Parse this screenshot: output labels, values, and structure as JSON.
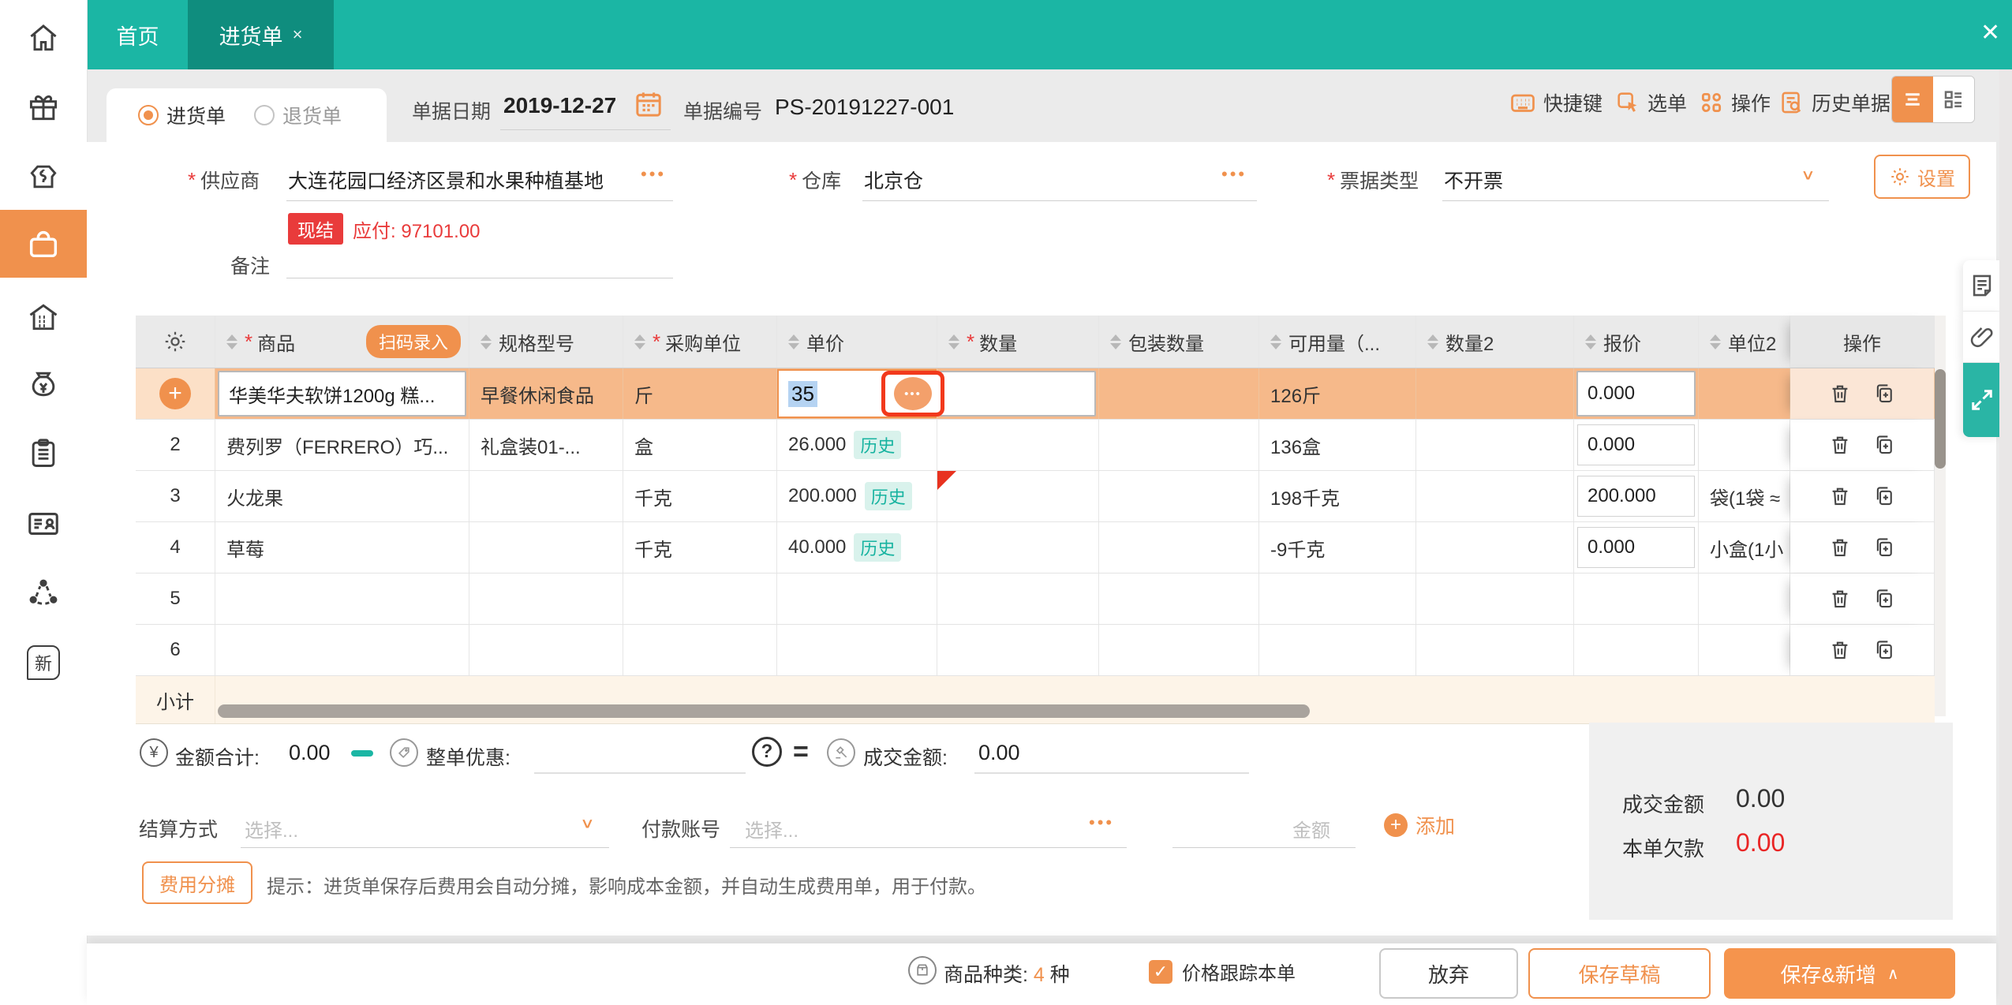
{
  "topbar": {
    "tabs": [
      {
        "label": "首页"
      },
      {
        "label": "进货单"
      }
    ],
    "tab_close": "×",
    "window_close": "✕"
  },
  "sidebar": {
    "new_badge": "新"
  },
  "header": {
    "type_options": [
      {
        "label": "进货单"
      },
      {
        "label": "退货单"
      }
    ],
    "date_label": "单据日期",
    "date_value": "2019-12-27",
    "number_label": "单据编号",
    "number_value": "PS-20191227-001",
    "actions": [
      {
        "label": "快捷键"
      },
      {
        "label": "选单"
      },
      {
        "label": "操作"
      },
      {
        "label": "历史单据"
      }
    ]
  },
  "form": {
    "required_mark": "*",
    "supplier_label": "供应商",
    "supplier_value": "大连花园口经济区景和水果种植基地",
    "settle_badge": "现结",
    "payable_label": "应付:",
    "payable_value": "97101.00",
    "warehouse_label": "仓库",
    "warehouse_value": "北京仓",
    "invoice_label": "票据类型",
    "invoice_value": "不开票",
    "settings_label": "设置",
    "remark_label": "备注"
  },
  "table": {
    "required_mark": "*",
    "scan_button": "扫码录入",
    "headers": {
      "product": "商品",
      "spec": "规格型号",
      "unit": "采购单位",
      "price": "单价",
      "qty": "数量",
      "pack": "包装数量",
      "avail": "可用量（...",
      "qty2": "数量2",
      "quote": "报价",
      "unit2": "单位2",
      "ops": "操作"
    },
    "history_badge": "历史",
    "rows": [
      {
        "num": "",
        "product": "华美华夫软饼1200g 糕...",
        "spec": "早餐休闲食品",
        "unit": "斤",
        "price": "35",
        "avail": "126斤",
        "quote": "0.000",
        "unit2": ""
      },
      {
        "num": "2",
        "product": "费列罗（FERRERO）巧...",
        "spec": "礼盒装01-...",
        "unit": "盒",
        "price": "26.000",
        "avail": "136盒",
        "quote": "0.000",
        "unit2": ""
      },
      {
        "num": "3",
        "product": "火龙果",
        "spec": "",
        "unit": "千克",
        "price": "200.000",
        "avail": "198千克",
        "quote": "200.000",
        "unit2": "袋(1袋 ≈"
      },
      {
        "num": "4",
        "product": "草莓",
        "spec": "",
        "unit": "千克",
        "price": "40.000",
        "avail": "-9千克",
        "quote": "0.000",
        "unit2": "小盒(1小"
      },
      {
        "num": "5"
      },
      {
        "num": "6"
      }
    ],
    "subtotal_label": "小计"
  },
  "summary": {
    "total_label": "金额合计:",
    "total_value": "0.00",
    "discount_label": "整单优惠:",
    "deal_label": "成交金额:",
    "deal_value": "0.00"
  },
  "payment": {
    "method_label": "结算方式",
    "method_placeholder": "选择...",
    "account_label": "付款账号",
    "account_placeholder": "选择...",
    "amount_placeholder": "金额",
    "add_label": "添加"
  },
  "fee": {
    "button_label": "费用分摊",
    "hint": "提示：进货单保存后费用会自动分摊，影响成本金额，并自动生成费用单，用于付款。"
  },
  "totals_box": {
    "deal_label": "成交金额",
    "deal_value": "0.00",
    "debt_label": "本单欠款",
    "debt_value": "0.00"
  },
  "footer": {
    "category_label": "商品种类:",
    "category_value": "4",
    "category_unit": "种",
    "track_label": "价格跟踪本单",
    "cancel_label": "放弃",
    "draft_label": "保存草稿",
    "save_label": "保存&新增"
  },
  "icons": {
    "dots": "•••",
    "chevron": "∨",
    "caret": "∧",
    "check": "✓",
    "plus": "+",
    "yuan": "¥",
    "question": "?",
    "equals": "=",
    "minus": "−"
  },
  "colors": {
    "teal": "#1bb6a4",
    "teal_dark": "#0f8d7e",
    "orange": "#f0914d",
    "red": "#e93b3b",
    "row_highlight": "#f6b98a"
  }
}
